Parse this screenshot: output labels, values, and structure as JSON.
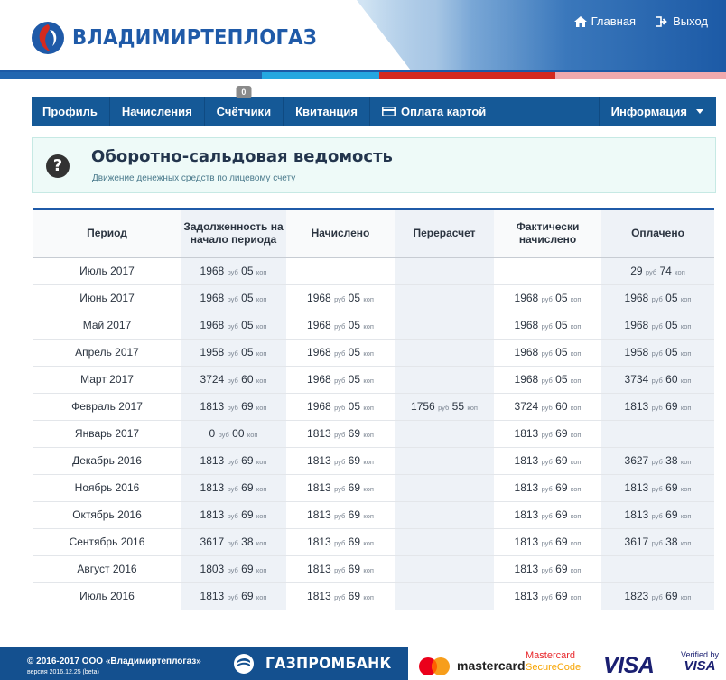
{
  "header": {
    "logo_text": "ВЛАДИМИРТЕПЛОГАЗ",
    "links": {
      "home": "Главная",
      "logout": "Выход"
    }
  },
  "nav": {
    "items": [
      "Профиль",
      "Начисления",
      "Счётчики",
      "Квитанция",
      "Оплата картой"
    ],
    "counter_badge": "0",
    "info": "Информация"
  },
  "info": {
    "title": "Оборотно-сальдовая ведомость",
    "subtitle": "Движение денежных средств по лицевому счету"
  },
  "table": {
    "headers": [
      "Период",
      "Задолженность на начало периода",
      "Начислено",
      "Перерасчет",
      "Фактически начислено",
      "Оплачено"
    ],
    "units": {
      "rub": "руб",
      "kop": "коп"
    },
    "rows": [
      [
        "Июль 2017",
        [
          "1968",
          "05"
        ],
        null,
        null,
        null,
        [
          "29",
          "74"
        ]
      ],
      [
        "Июнь 2017",
        [
          "1968",
          "05"
        ],
        [
          "1968",
          "05"
        ],
        null,
        [
          "1968",
          "05"
        ],
        [
          "1968",
          "05"
        ]
      ],
      [
        "Май 2017",
        [
          "1968",
          "05"
        ],
        [
          "1968",
          "05"
        ],
        null,
        [
          "1968",
          "05"
        ],
        [
          "1968",
          "05"
        ]
      ],
      [
        "Апрель 2017",
        [
          "1958",
          "05"
        ],
        [
          "1968",
          "05"
        ],
        null,
        [
          "1968",
          "05"
        ],
        [
          "1958",
          "05"
        ]
      ],
      [
        "Март 2017",
        [
          "3724",
          "60"
        ],
        [
          "1968",
          "05"
        ],
        null,
        [
          "1968",
          "05"
        ],
        [
          "3734",
          "60"
        ]
      ],
      [
        "Февраль 2017",
        [
          "1813",
          "69"
        ],
        [
          "1968",
          "05"
        ],
        [
          "1756",
          "55"
        ],
        [
          "3724",
          "60"
        ],
        [
          "1813",
          "69"
        ]
      ],
      [
        "Январь 2017",
        [
          "0",
          "00"
        ],
        [
          "1813",
          "69"
        ],
        null,
        [
          "1813",
          "69"
        ],
        null
      ],
      [
        "Декабрь 2016",
        [
          "1813",
          "69"
        ],
        [
          "1813",
          "69"
        ],
        null,
        [
          "1813",
          "69"
        ],
        [
          "3627",
          "38"
        ]
      ],
      [
        "Ноябрь 2016",
        [
          "1813",
          "69"
        ],
        [
          "1813",
          "69"
        ],
        null,
        [
          "1813",
          "69"
        ],
        [
          "1813",
          "69"
        ]
      ],
      [
        "Октябрь 2016",
        [
          "1813",
          "69"
        ],
        [
          "1813",
          "69"
        ],
        null,
        [
          "1813",
          "69"
        ],
        [
          "1813",
          "69"
        ]
      ],
      [
        "Сентябрь 2016",
        [
          "3617",
          "38"
        ],
        [
          "1813",
          "69"
        ],
        null,
        [
          "1813",
          "69"
        ],
        [
          "3617",
          "38"
        ]
      ],
      [
        "Август 2016",
        [
          "1803",
          "69"
        ],
        [
          "1813",
          "69"
        ],
        null,
        [
          "1813",
          "69"
        ],
        null
      ],
      [
        "Июль 2016",
        [
          "1813",
          "69"
        ],
        [
          "1813",
          "69"
        ],
        null,
        [
          "1813",
          "69"
        ],
        [
          "1823",
          "69"
        ]
      ]
    ]
  },
  "footer": {
    "copyright": "© 2016-2017 ООО «Владимиртеплогаз»",
    "version": "версия 2016.12.25 (beta)",
    "bank": "ГАЗПРОМБАНК",
    "mastercard": "mastercard",
    "mc_securecode_1": "Mastercard",
    "mc_securecode_2": "SecureCode",
    "visa": "VISA",
    "verified_by": "Verified by",
    "verified_visa": "VISA"
  },
  "colors": {
    "brand_blue": "#155997",
    "header_blue": "#1f5aa8",
    "stripe_red": "#d42a1f",
    "stripe_cyan": "#25a7e0"
  }
}
